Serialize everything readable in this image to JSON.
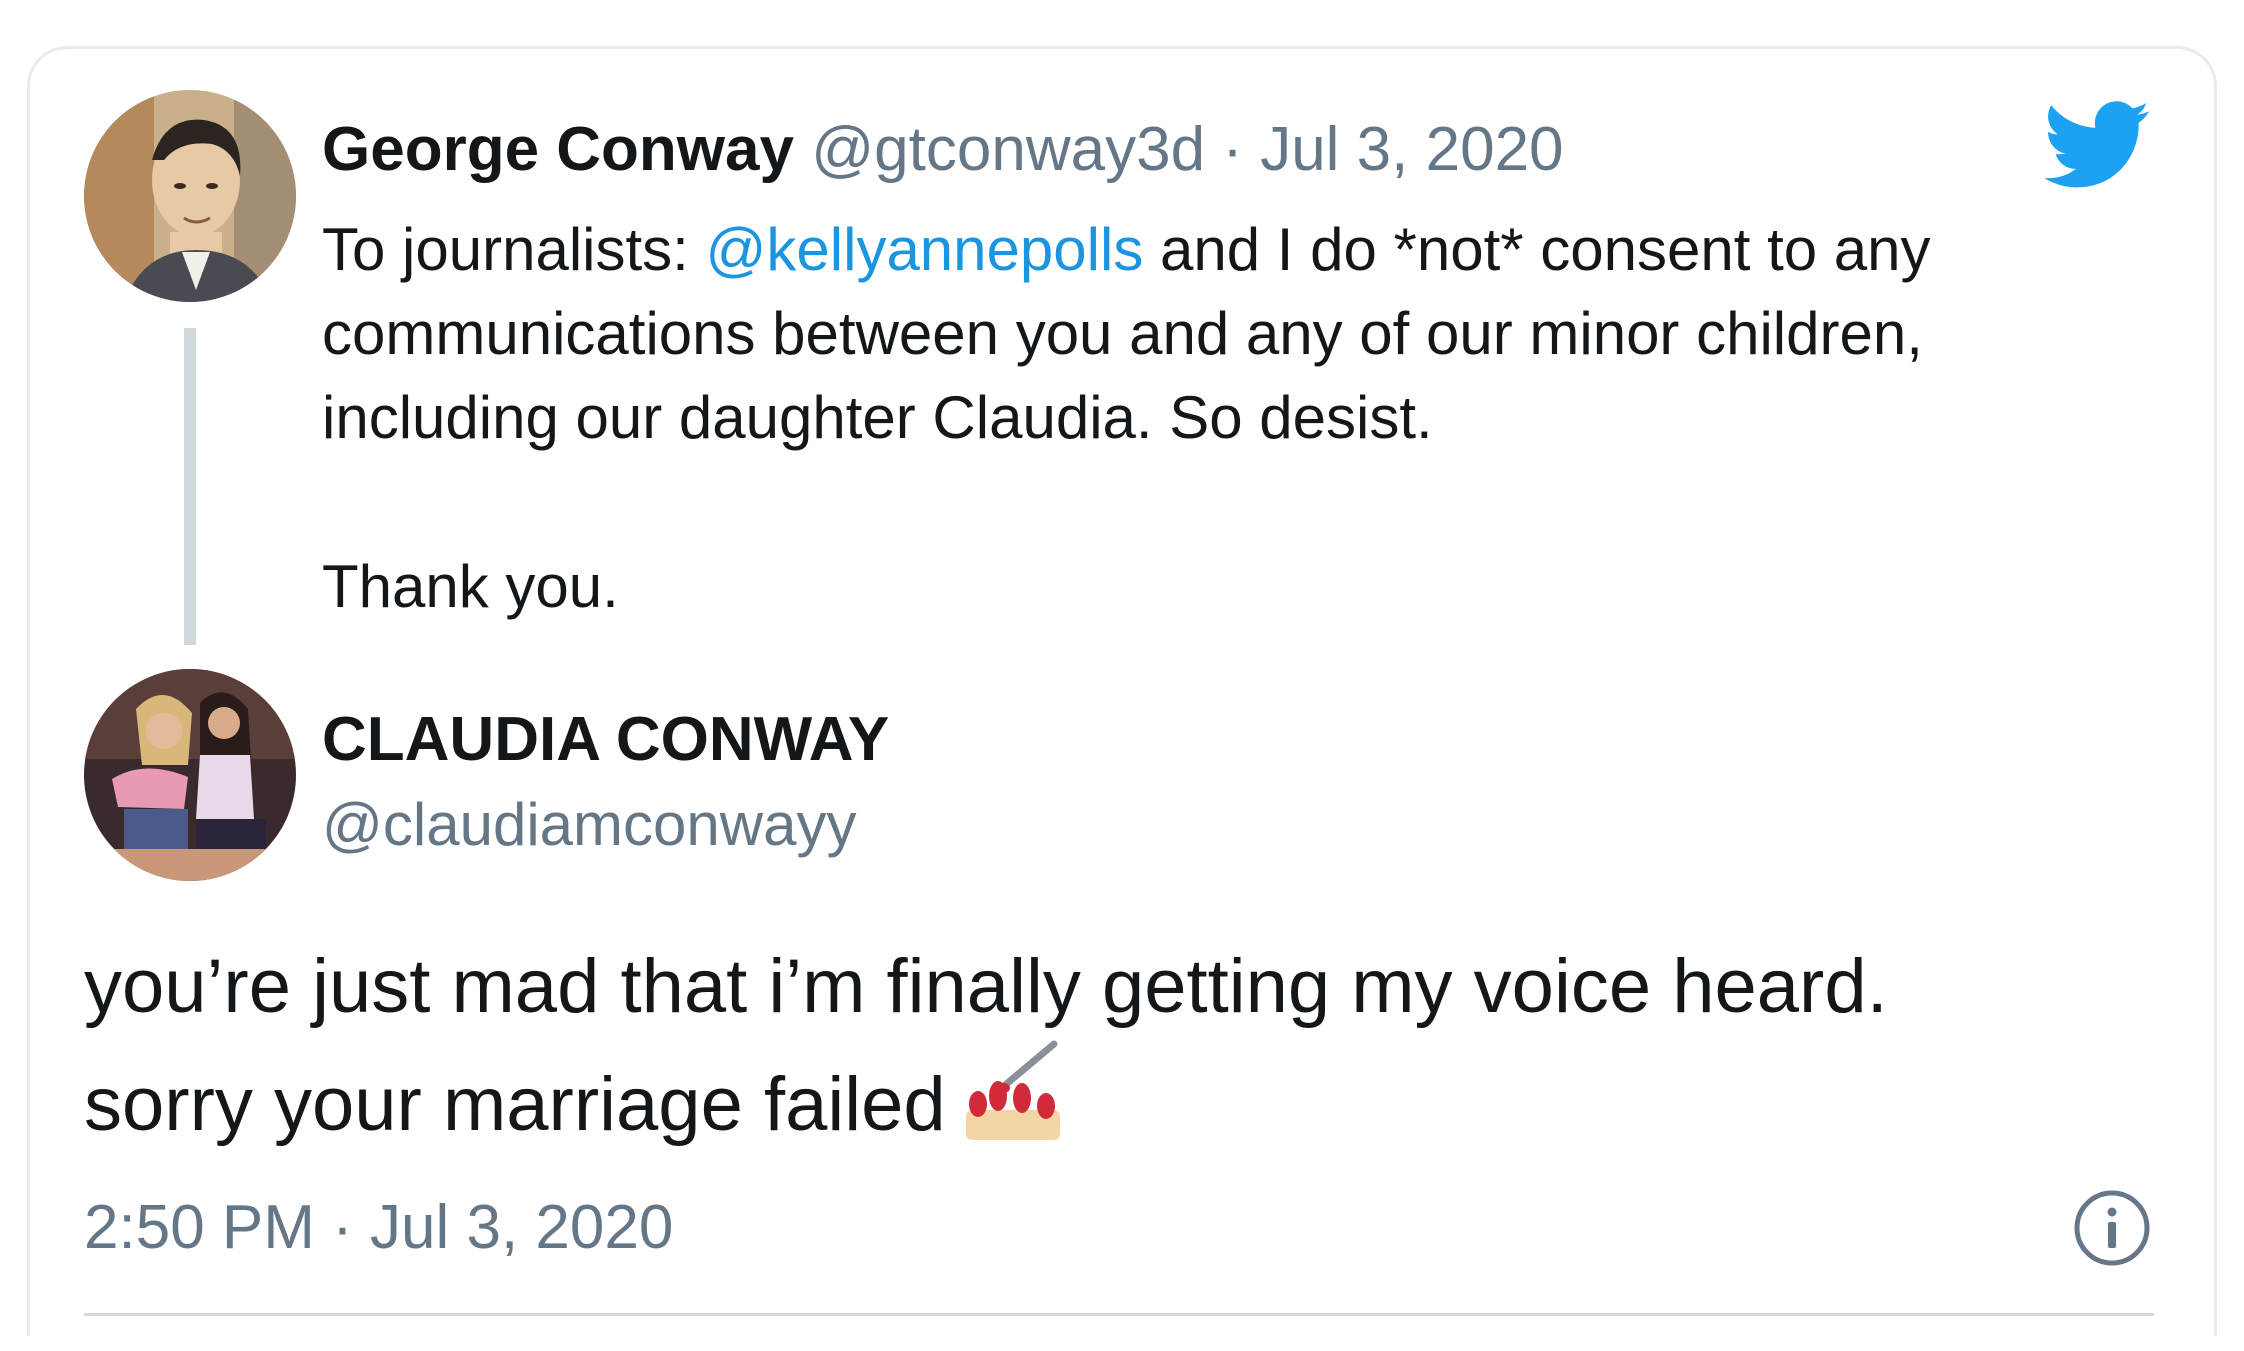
{
  "quoted_tweet": {
    "display_name": "George Conway",
    "handle": "@gtconway3d",
    "separator": "·",
    "date": "Jul 3, 2020",
    "text_lines": [
      {
        "prefix": "To journalists:  ",
        "mention": "@kellyannepolls",
        "suffix": " and I do *not* consent to any"
      },
      "communications between you and any of our minor children,",
      "including our daughter Claudia.  So desist.",
      "",
      "Thank you."
    ],
    "avatar_icon": "sketch-portrait-avatar"
  },
  "reply_tweet": {
    "display_name": "CLAUDIA CONWAY",
    "handle": "@claudiamconwayy",
    "text_lines": [
      "you’re just mad that i’m finally getting my voice heard.",
      "sorry your marriage failed"
    ],
    "emoji": "nail-polish-emoji",
    "timestamp": "2:50 PM · Jul 3, 2020",
    "avatar_icon": "photo-avatar"
  },
  "icons": {
    "brand": "twitter-bird-icon",
    "info": "info-icon"
  },
  "colors": {
    "text": "#14171a",
    "secondary": "#657786",
    "link": "#1b95e0",
    "twitter_blue": "#1da1f2",
    "border": "#cfd9de"
  }
}
